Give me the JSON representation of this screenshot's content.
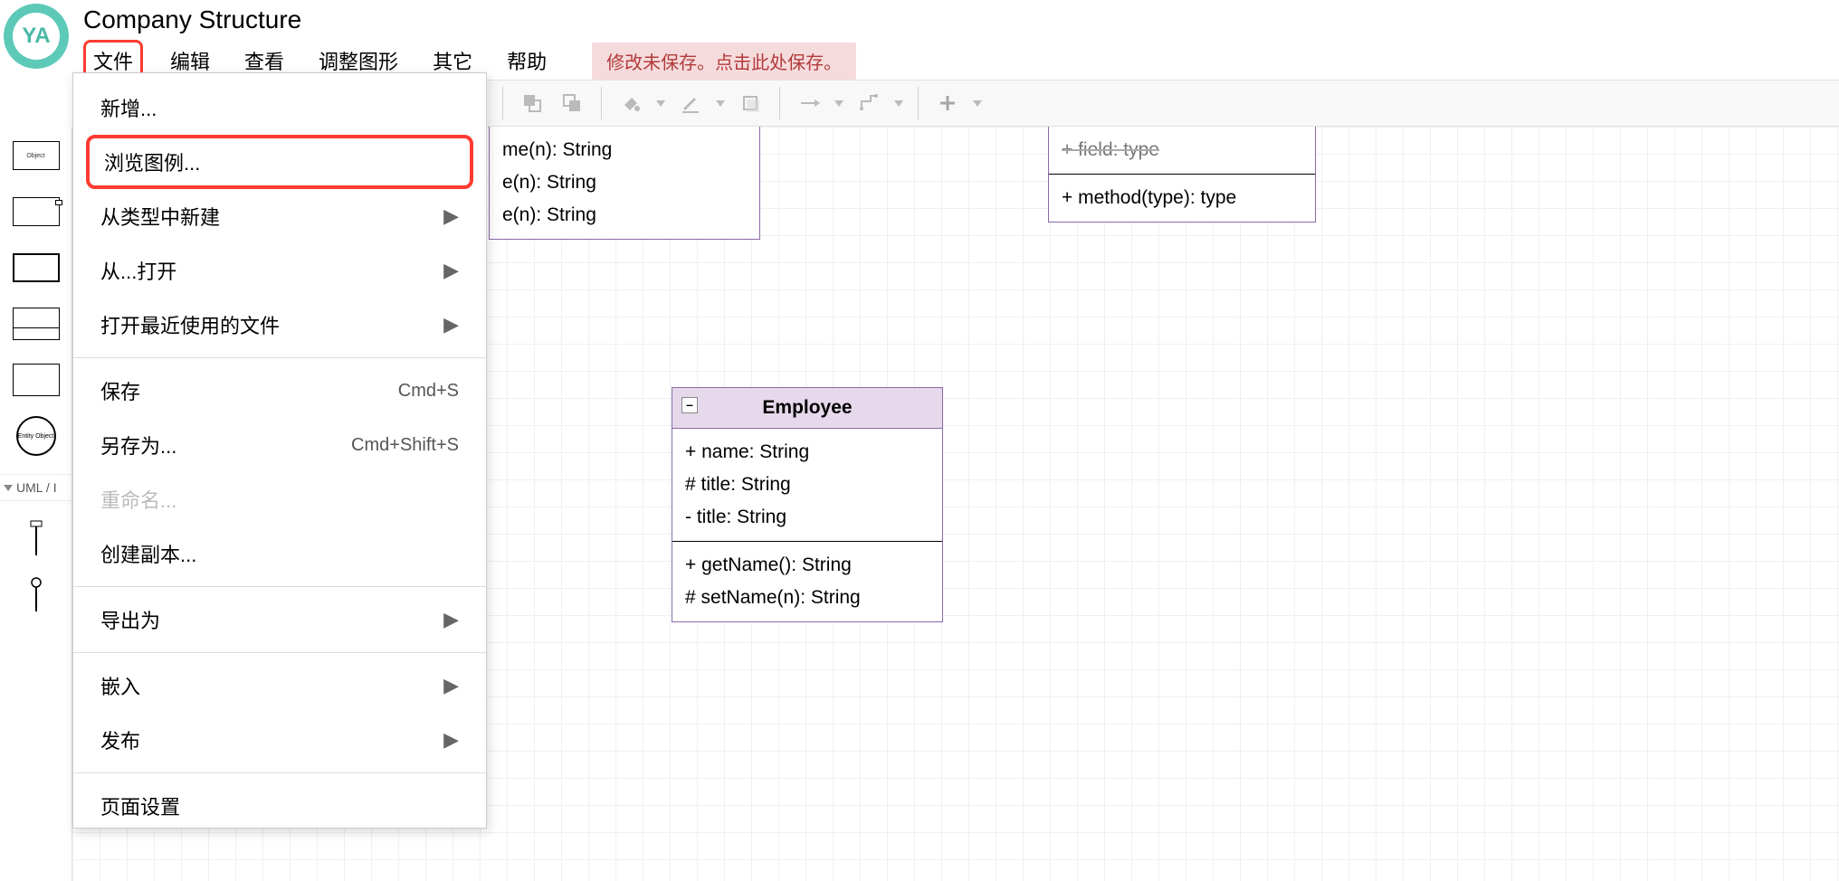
{
  "header": {
    "avatar_text": "YA",
    "title": "Company Structure",
    "menu": {
      "file": "文件",
      "edit": "编辑",
      "view": "查看",
      "arrange": "调整图形",
      "extras": "其它",
      "help": "帮助"
    },
    "save_notice": "修改未保存。点击此处保存。"
  },
  "file_menu": {
    "new": "新增...",
    "browse_templates": "浏览图例...",
    "new_from_type": "从类型中新建",
    "open_from": "从...打开",
    "open_recent": "打开最近使用的文件",
    "save": "保存",
    "save_shortcut": "Cmd+S",
    "save_as": "另存为...",
    "save_as_shortcut": "Cmd+Shift+S",
    "rename": "重命名...",
    "make_copy": "创建副本...",
    "export_as": "导出为",
    "embed": "嵌入",
    "publish": "发布",
    "page_setup": "页面设置"
  },
  "shapes_sidebar": {
    "section_label": "UML / I",
    "thumb_object": "Object",
    "thumb_entity": "Entity Object"
  },
  "canvas": {
    "class1": {
      "methods": [
        "me(n): String",
        "e(n): String",
        "e(n): String"
      ]
    },
    "class2": {
      "field_partial": "+ field: type",
      "method": "+ method(type): type"
    },
    "class3": {
      "name": "Employee",
      "collapse": "–",
      "fields": [
        "+ name: String",
        "# title: String",
        "- title: String"
      ],
      "methods": [
        "+ getName(): String",
        "# setName(n): String"
      ]
    }
  }
}
